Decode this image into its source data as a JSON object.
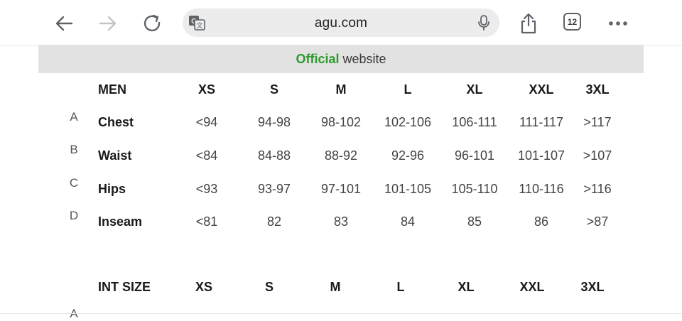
{
  "browser": {
    "url": "agu.com",
    "tabs_count": "12",
    "icons": {
      "back": "arrow-left-icon",
      "forward": "arrow-right-icon",
      "reload": "reload-icon",
      "translate": "translate-icon",
      "mic": "microphone-icon",
      "share": "share-icon",
      "more": "more-dots-icon"
    }
  },
  "banner": {
    "highlight": "Official",
    "rest": " website"
  },
  "men_table": {
    "title": "MEN",
    "sizes": [
      "XS",
      "S",
      "M",
      "L",
      "XL",
      "XXL",
      "3XL"
    ],
    "rows": [
      {
        "letter": "A",
        "label": "Chest",
        "values": [
          "<94",
          "94-98",
          "98-102",
          "102-106",
          "106-111",
          "111-117",
          ">117"
        ]
      },
      {
        "letter": "B",
        "label": "Waist",
        "values": [
          "<84",
          "84-88",
          "88-92",
          "92-96",
          "96-101",
          "101-107",
          ">107"
        ]
      },
      {
        "letter": "C",
        "label": "Hips",
        "values": [
          "<93",
          "93-97",
          "97-101",
          "101-105",
          "105-110",
          "110-116",
          ">116"
        ]
      },
      {
        "letter": "D",
        "label": "Inseam",
        "values": [
          "<81",
          "82",
          "83",
          "84",
          "85",
          "86",
          ">87"
        ]
      }
    ]
  },
  "int_table": {
    "title": "INT SIZE",
    "sizes": [
      "XS",
      "S",
      "M",
      "L",
      "XL",
      "XXL",
      "3XL"
    ],
    "first_letter": "A"
  },
  "colors": {
    "accent_green": "#2e9a2e",
    "banner_bg": "#e2e2e2",
    "url_bg": "#ececec"
  }
}
